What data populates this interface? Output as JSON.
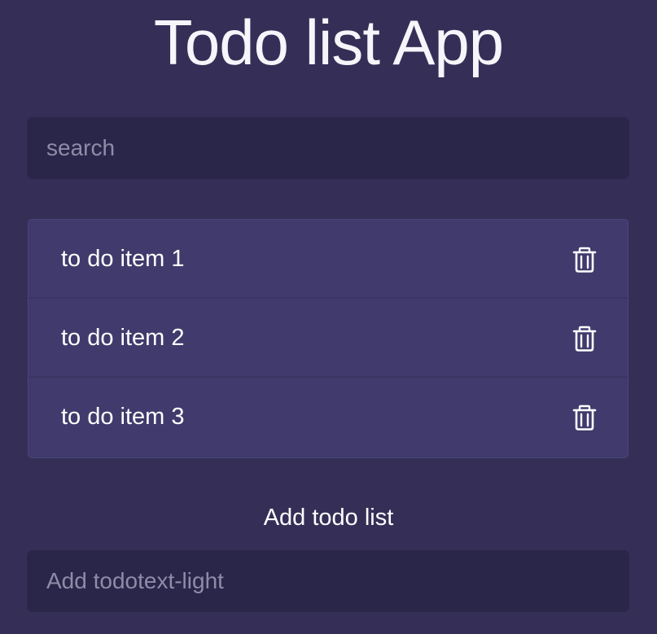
{
  "app": {
    "title": "Todo list App"
  },
  "search": {
    "placeholder": "search",
    "value": ""
  },
  "todos": {
    "items": [
      {
        "text": "to do item 1",
        "action_icon": "trash-icon"
      },
      {
        "text": "to do item 2",
        "action_icon": "trash-icon"
      },
      {
        "text": "to do item 3",
        "action_icon": "trash-icon"
      }
    ]
  },
  "add": {
    "label": "Add todo list",
    "placeholder": "Add todotext-light",
    "value": ""
  },
  "colors": {
    "background": "#352f57",
    "input_background": "#2a2649",
    "list_background": "#403b6c",
    "text": "#ffffff",
    "placeholder": "#8f8ba8"
  }
}
